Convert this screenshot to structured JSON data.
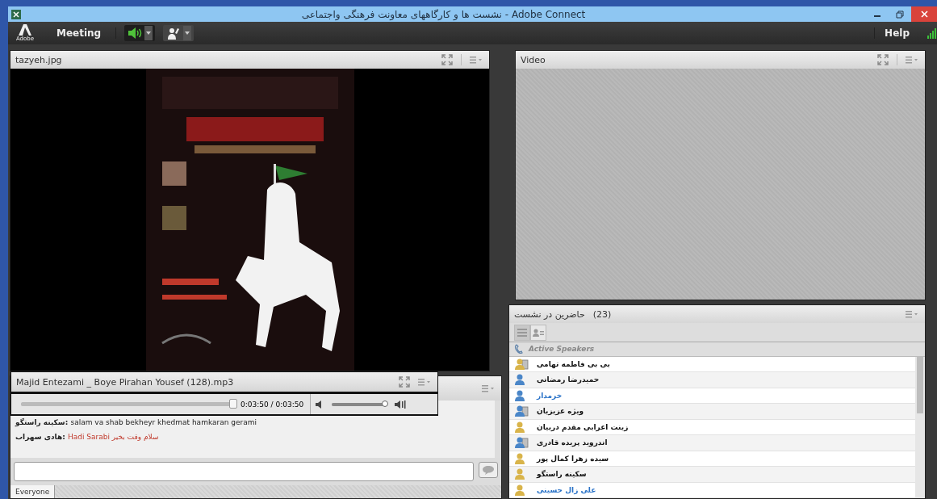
{
  "window": {
    "title": "نشست ها و کارگاههای معاونت فرهنگی واجتماعی - Adobe Connect"
  },
  "menubar": {
    "logo_text": "Adobe",
    "menus": [
      "Meeting"
    ],
    "speaker_on": true,
    "help": "Help"
  },
  "share_pod": {
    "title": "tazyeh.jpg"
  },
  "video_pod": {
    "title": "Video"
  },
  "mp3_pod": {
    "title": "Majid Entezami _ Boye Pirahan Yousef (128).mp3",
    "time": "0:03:50 / 0:03:50",
    "progress": {
      "level": 0.98
    },
    "volume": {
      "level": 1
    }
  },
  "chat_pod": {
    "messages": [
      {
        "sender": "سکینه راستگو:",
        "text": "salam va shab bekheyr khedmat hamkaran gerami",
        "kind": "plain"
      },
      {
        "sender": "هادی سهراب:",
        "text": "Hadi Sarabi سلام وقت بخیر",
        "kind": "colored"
      }
    ],
    "tabs": [
      {
        "label": "Everyone",
        "selected": true
      }
    ]
  },
  "attendees_pod": {
    "title": "حاضرین در نشست",
    "count": "(23)",
    "views": [
      {
        "kind": "list",
        "selected": true
      },
      {
        "kind": "cards",
        "selected": false
      }
    ],
    "section": "Active Speakers",
    "people": [
      {
        "name": "بی بی فاطمه تهامی",
        "kind": "host",
        "color": "#d9b44a",
        "highlighted": false
      },
      {
        "name": "حمیدرضا رمضانی",
        "kind": "participant",
        "color": "#4a86c8",
        "highlighted": false
      },
      {
        "name": "خرمدار",
        "kind": "participant",
        "color": "#4a86c8",
        "highlighted": true
      },
      {
        "name": "ویژه عزیزیان",
        "kind": "host",
        "color": "#4a86c8",
        "highlighted": false
      },
      {
        "name": "زینت اعرابی مقدم دربیان",
        "kind": "participant",
        "color": "#d9b44a",
        "highlighted": false
      },
      {
        "name": "اندروید پریده قادری",
        "kind": "host",
        "color": "#4a86c8",
        "highlighted": false
      },
      {
        "name": "سیده زهرا کمال پور",
        "kind": "participant",
        "color": "#d9b44a",
        "highlighted": false
      },
      {
        "name": "سکینه راستگو",
        "kind": "participant",
        "color": "#d9b44a",
        "highlighted": false
      },
      {
        "name": "علی زال حسینی",
        "kind": "participant",
        "color": "#d9b44a",
        "highlighted": true
      }
    ]
  }
}
